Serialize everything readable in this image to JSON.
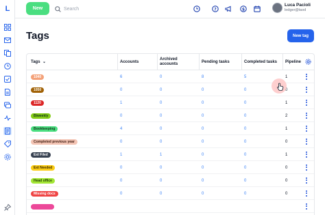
{
  "sidebar": {
    "logo": "L",
    "icons": [
      "grid-icon",
      "inbox-icon",
      "documents-icon",
      "clock-icon",
      "check-icon",
      "file-icon",
      "chat-icon",
      "activity-icon",
      "receipt-icon",
      "tag-icon",
      "settings-icon",
      "pin-icon"
    ]
  },
  "topbar": {
    "new_label": "New",
    "search_placeholder": "Search",
    "user_name": "Luca Pacioli",
    "user_email": "ledger@taxd"
  },
  "page": {
    "title": "Tags",
    "new_tag_label": "New tag"
  },
  "table": {
    "headers": {
      "tags": "Tags",
      "accounts": "Accounts",
      "archived": "Archived accounts",
      "pending": "Pending tasks",
      "completed": "Completed tasks",
      "pipeline": "Pipeline"
    },
    "rows": [
      {
        "tag": "1040",
        "color": "#f4a27a",
        "text": "#ffffff",
        "accounts": "6",
        "archived": "0",
        "pending": "8",
        "completed": "5",
        "pipeline": "1"
      },
      {
        "tag": "1050",
        "color": "#a16207",
        "text": "#ffffff",
        "accounts": "0",
        "archived": "0",
        "pending": "0",
        "completed": "0",
        "pipeline": "0"
      },
      {
        "tag": "1120",
        "color": "#dc2626",
        "text": "#ffffff",
        "accounts": "1",
        "archived": "0",
        "pending": "0",
        "completed": "0",
        "pipeline": "1"
      },
      {
        "tag": "Biweekly",
        "color": "#84cc16",
        "text": "#14361a",
        "accounts": "0",
        "archived": "0",
        "pending": "0",
        "completed": "0",
        "pipeline": "2"
      },
      {
        "tag": "Bookkeeping",
        "color": "#4ade80",
        "text": "#14361a",
        "accounts": "4",
        "archived": "0",
        "pending": "0",
        "completed": "0",
        "pipeline": "1"
      },
      {
        "tag": "Completed previous year",
        "color": "#f3c4b4",
        "text": "#3f1d12",
        "accounts": "0",
        "archived": "0",
        "pending": "0",
        "completed": "0",
        "pipeline": "0"
      },
      {
        "tag": "Ext Filed",
        "color": "#374151",
        "text": "#ffffff",
        "accounts": "1",
        "archived": "1",
        "pending": "0",
        "completed": "0",
        "pipeline": "1"
      },
      {
        "tag": "Ext Needed",
        "color": "#facc15",
        "text": "#3b2a00",
        "accounts": "0",
        "archived": "0",
        "pending": "0",
        "completed": "0",
        "pipeline": "0"
      },
      {
        "tag": "Head office",
        "color": "#a3e635",
        "text": "#1f3a06",
        "accounts": "0",
        "archived": "0",
        "pending": "0",
        "completed": "0",
        "pipeline": "0"
      },
      {
        "tag": "Missing docs",
        "color": "#ef4444",
        "text": "#ffffff",
        "accounts": "0",
        "archived": "0",
        "pending": "0",
        "completed": "0",
        "pipeline": "0"
      },
      {
        "tag": "",
        "color": "#ec4899",
        "text": "#ffffff",
        "accounts": "",
        "archived": "",
        "pending": "",
        "completed": "",
        "pipeline": ""
      }
    ]
  }
}
